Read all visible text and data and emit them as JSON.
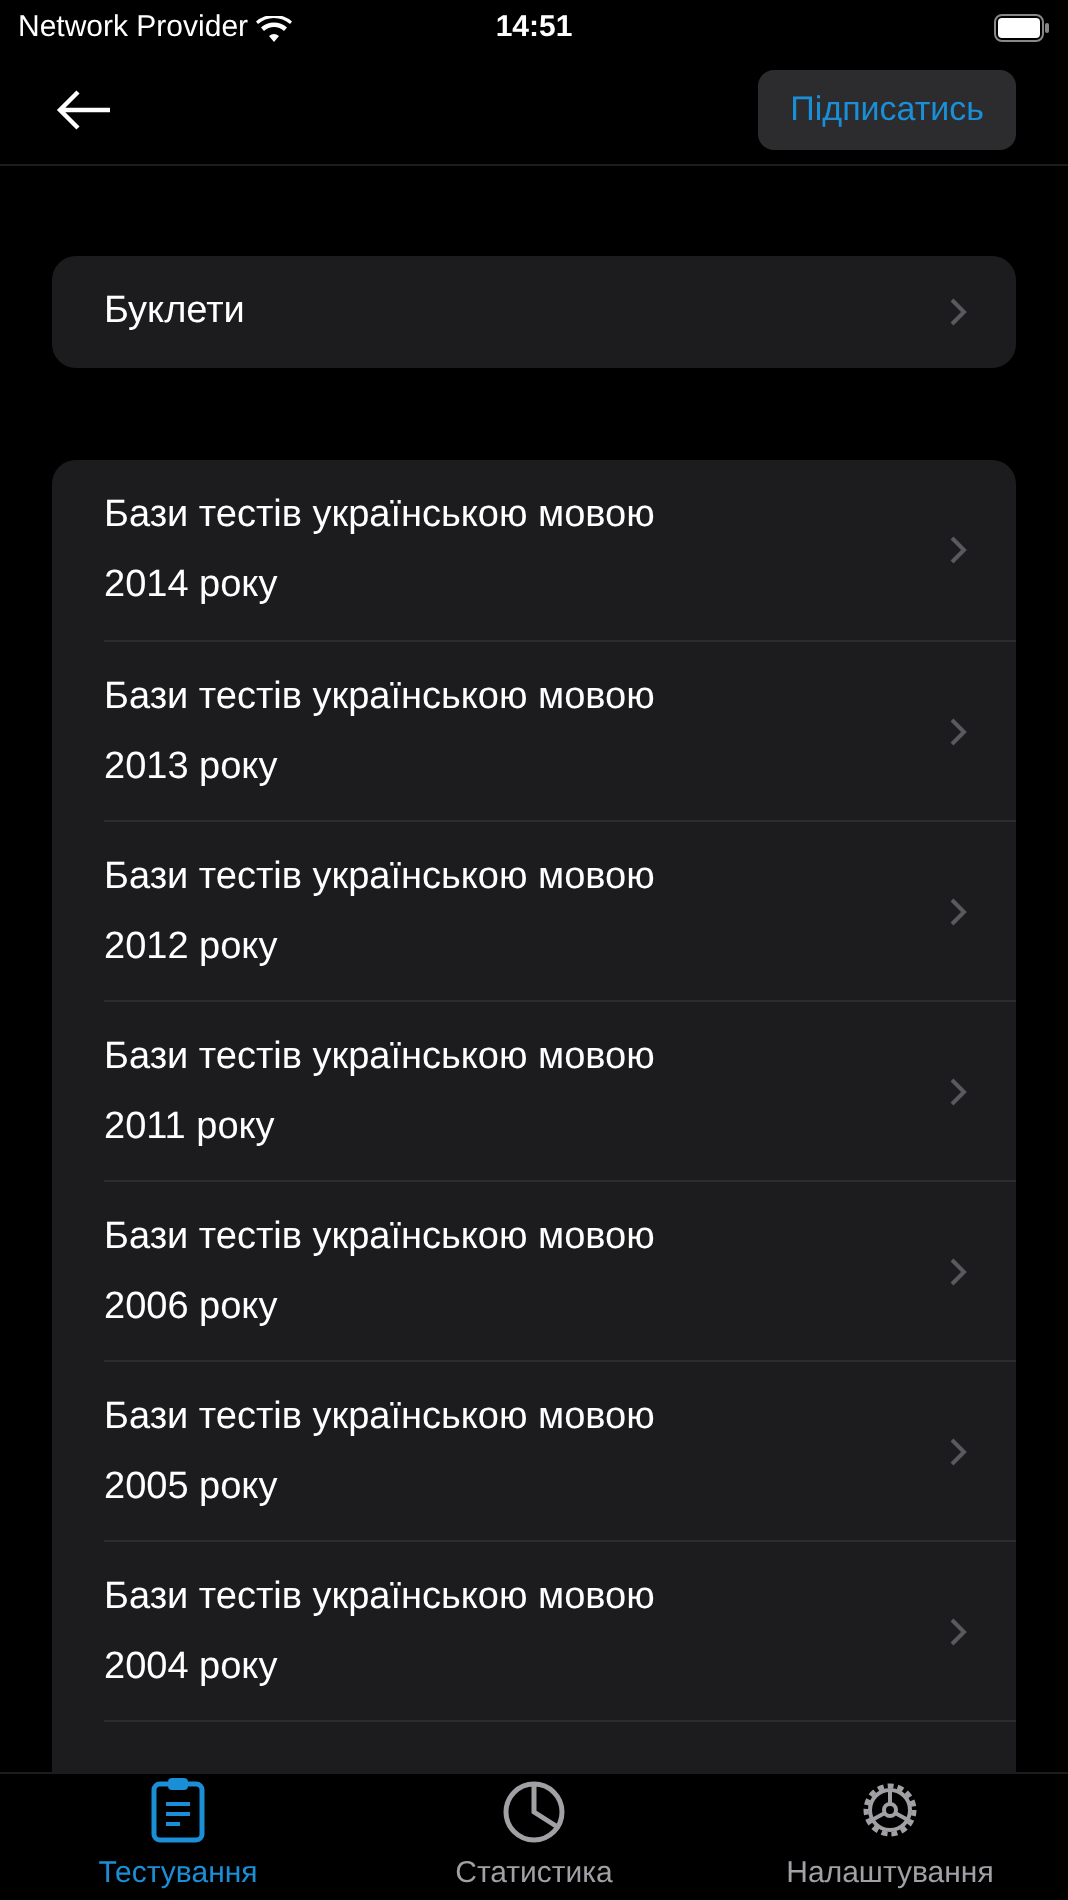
{
  "status_bar": {
    "carrier": "Network Provider",
    "time": "14:51"
  },
  "nav_bar": {
    "action_button": "Підписатись"
  },
  "booklets": {
    "label": "Буклети"
  },
  "tests": [
    {
      "title": "Бази тестів українською мовою",
      "year": "2014 року"
    },
    {
      "title": "Бази тестів українською мовою",
      "year": "2013 року"
    },
    {
      "title": "Бази тестів українською мовою",
      "year": "2012 року"
    },
    {
      "title": "Бази тестів українською мовою",
      "year": "2011 року"
    },
    {
      "title": "Бази тестів українською мовою",
      "year": "2006 року"
    },
    {
      "title": "Бази тестів українською мовою",
      "year": "2005 року"
    },
    {
      "title": "Бази тестів українською мовою",
      "year": "2004 року"
    }
  ],
  "tab_bar": [
    {
      "label": "Тестування",
      "kind": "clipboard",
      "selected": true
    },
    {
      "label": "Статистика",
      "kind": "pie",
      "selected": false
    },
    {
      "label": "Налаштування",
      "kind": "gear",
      "selected": false
    }
  ]
}
